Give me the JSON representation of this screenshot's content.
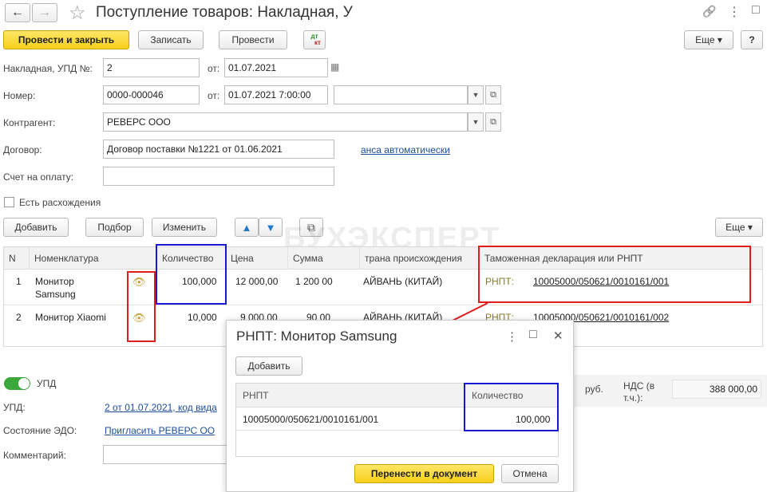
{
  "window": {
    "title": "Поступление товаров: Накладная, У",
    "back_glyph": "←",
    "forward_glyph": "→",
    "star_glyph": "☆",
    "link_glyph": "🔗",
    "menu_glyph": "⋮",
    "max_glyph": "□",
    "close_glyph": "✕"
  },
  "toolbar": {
    "post_close": "Провести и закрыть",
    "save": "Записать",
    "post": "Провести",
    "dtkt_top": "дт",
    "dtkt_bottom": "кт",
    "more": "Еще ▾",
    "help": "?"
  },
  "form": {
    "invoice_label": "Накладная, УПД №:",
    "invoice_value": "2",
    "from_label": "от:",
    "invoice_date": "01.07.2021",
    "number_label": "Номер:",
    "number_value": "0000-000046",
    "number_from_label": "от:",
    "number_date": "01.07.2021  7:00:00",
    "counterparty_label": "Контрагент:",
    "counterparty_value": "РЕВЕРС ООО",
    "contract_label": "Договор:",
    "contract_value": "Договор поставки №1221 от 01.06.2021",
    "contract_link": "анса автоматически",
    "payment_label": "Счет на оплату:",
    "discrepancy_label": "Есть расхождения"
  },
  "table_toolbar": {
    "add": "Добавить",
    "select": "Подбор",
    "edit": "Изменить",
    "up": "🡅",
    "down": "🡇",
    "copy": "⧉",
    "more": "Еще ▾"
  },
  "watermark": "БУХЭКСПЕРТ",
  "table": {
    "headers": {
      "n": "N",
      "nomenclature": "Номенклатура",
      "quantity": "Количество",
      "price": "Цена",
      "sum": "Сумма",
      "country": "трана происхождения",
      "customs": "Таможенная декларация или РНПТ"
    },
    "rows": [
      {
        "n": "1",
        "name1": "Монитор",
        "name2": "Samsung",
        "qty": "100,000",
        "price": "12 000,00",
        "sum": "1 200 00",
        "country": "АЙВАНЬ (КИТАЙ)",
        "rnpt_label": "РНПТ:",
        "rnpt": "10005000/050621/0010161/001"
      },
      {
        "n": "2",
        "name1": "Монитор Xiaomi",
        "name2": "",
        "qty": "10,000",
        "price": "9 000,00",
        "sum": "90 00",
        "country": "АЙВАНЬ (КИТАЙ)",
        "rnpt_label": "РНПТ:",
        "rnpt": "10005000/050621/0010161/002"
      }
    ]
  },
  "footer": {
    "upd_toggle": "УПД",
    "upd_label": "УПД:",
    "upd_link": "2 от 01.07.2021, код вида",
    "edo_label": "Состояние ЭДО:",
    "edo_link": "Пригласить РЕВЕРС ОО",
    "comment_label": "Комментарий:",
    "currency": "руб.",
    "vat_label_1": "НДС (в",
    "vat_label_2": "т.ч.):",
    "vat_value": "388 000,00"
  },
  "dialog": {
    "title": "РНПТ: Монитор Samsung",
    "menu_glyph": "⋮",
    "max_glyph": "□",
    "close_glyph": "✕",
    "add": "Добавить",
    "col_rnpt": "РНПТ",
    "col_qty": "Количество",
    "row_rnpt": "10005000/050621/0010161/001",
    "row_qty": "100,000",
    "transfer": "Перенести в документ",
    "cancel": "Отмена"
  }
}
